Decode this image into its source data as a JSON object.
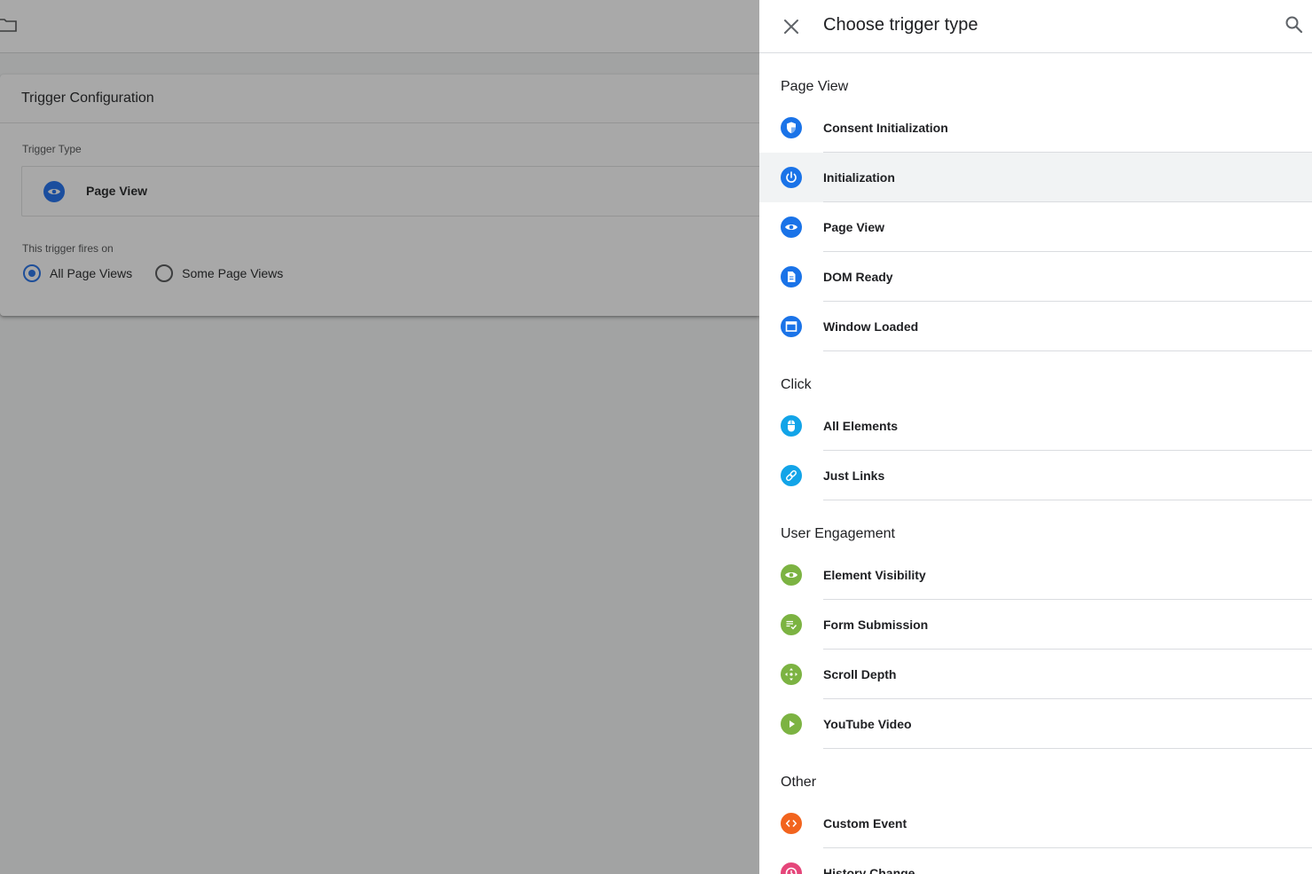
{
  "colors": {
    "blue": "#1a73e8",
    "cyan": "#12a4e8",
    "green": "#7cb342",
    "orange": "#f2641e",
    "pink": "#e5467a",
    "highlight": "#f1f3f4"
  },
  "background": {
    "card_title": "Trigger Configuration",
    "trigger_type_label": "Trigger Type",
    "trigger_type_value": "Page View",
    "fires_on_label": "This trigger fires on",
    "radio_options": [
      {
        "label": "All Page Views",
        "selected": true
      },
      {
        "label": "Some Page Views",
        "selected": false
      }
    ]
  },
  "drawer": {
    "title": "Choose trigger type",
    "close_icon": "close-icon",
    "search_icon": "search-icon",
    "sections": [
      {
        "title": "Page View",
        "items": [
          {
            "label": "Consent Initialization",
            "icon": "shield-icon",
            "color": "#1a73e8"
          },
          {
            "label": "Initialization",
            "icon": "power-icon",
            "color": "#1a73e8",
            "highlighted": true
          },
          {
            "label": "Page View",
            "icon": "eye-icon",
            "color": "#1a73e8"
          },
          {
            "label": "DOM Ready",
            "icon": "document-icon",
            "color": "#1a73e8"
          },
          {
            "label": "Window Loaded",
            "icon": "window-icon",
            "color": "#1a73e8"
          }
        ]
      },
      {
        "title": "Click",
        "items": [
          {
            "label": "All Elements",
            "icon": "mouse-icon",
            "color": "#12a4e8"
          },
          {
            "label": "Just Links",
            "icon": "link-icon",
            "color": "#12a4e8"
          }
        ]
      },
      {
        "title": "User Engagement",
        "items": [
          {
            "label": "Element Visibility",
            "icon": "eye-icon",
            "color": "#7cb342"
          },
          {
            "label": "Form Submission",
            "icon": "form-check-icon",
            "color": "#7cb342"
          },
          {
            "label": "Scroll Depth",
            "icon": "move-arrows-icon",
            "color": "#7cb342"
          },
          {
            "label": "YouTube Video",
            "icon": "play-icon",
            "color": "#7cb342"
          }
        ]
      },
      {
        "title": "Other",
        "items": [
          {
            "label": "Custom Event",
            "icon": "code-icon",
            "color": "#f2641e"
          },
          {
            "label": "History Change",
            "icon": "clock-icon",
            "color": "#e5467a"
          }
        ]
      }
    ]
  }
}
